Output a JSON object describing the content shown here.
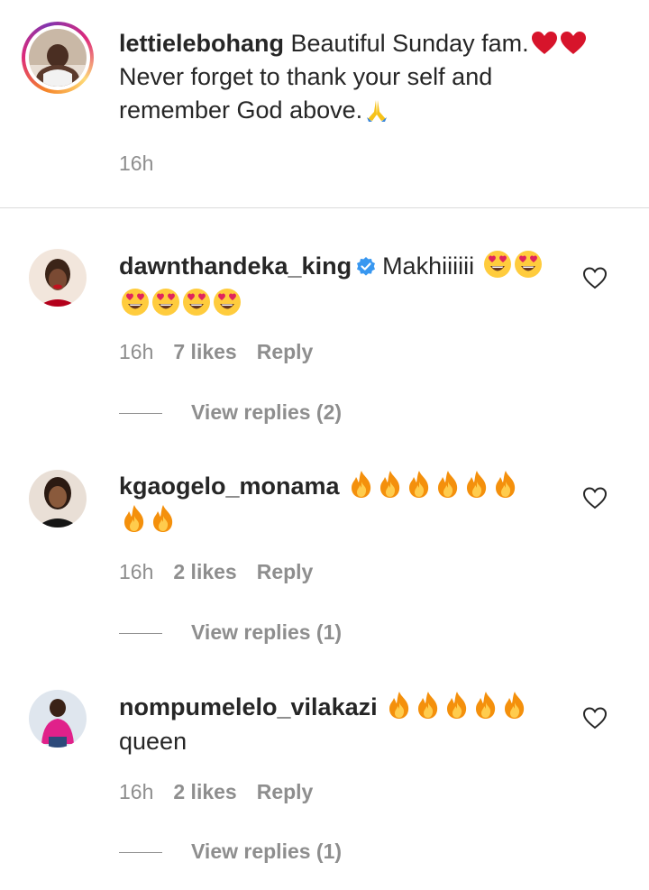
{
  "caption": {
    "username": "lettielebohang",
    "text_line1": " Beautiful Sunday fam.",
    "text_line2": "Never forget to thank your self and",
    "text_line3": "remember God above.",
    "time": "16h"
  },
  "comments": [
    {
      "username": "dawnthandeka_king",
      "verified": true,
      "text": "Makhiiiiii",
      "emoji": [
        "heart-eyes",
        "heart-eyes",
        "heart-eyes",
        "heart-eyes",
        "heart-eyes",
        "heart-eyes"
      ],
      "time": "16h",
      "likes": "7 likes",
      "reply_label": "Reply",
      "view_replies": "View replies (2)"
    },
    {
      "username": "kgaogelo_monama",
      "verified": false,
      "text": "",
      "emoji": [
        "fire",
        "fire",
        "fire",
        "fire",
        "fire",
        "fire",
        "fire",
        "fire"
      ],
      "time": "16h",
      "likes": "2 likes",
      "reply_label": "Reply",
      "view_replies": "View replies (1)"
    },
    {
      "username": "nompumelelo_vilakazi",
      "verified": false,
      "text": "queen",
      "emoji": [
        "fire",
        "fire",
        "fire",
        "fire",
        "fire"
      ],
      "time": "16h",
      "likes": "2 likes",
      "reply_label": "Reply",
      "view_replies": "View replies (1)"
    }
  ],
  "colors": {
    "text": "#262626",
    "secondary": "#8e8e8e",
    "verified": "#3897f0",
    "divider": "#dbdbdb"
  },
  "icons": {
    "like": "heart-outline-icon",
    "verified": "verified-badge-icon",
    "pray": "pray-emoji",
    "red_heart": "red-heart-emoji"
  }
}
